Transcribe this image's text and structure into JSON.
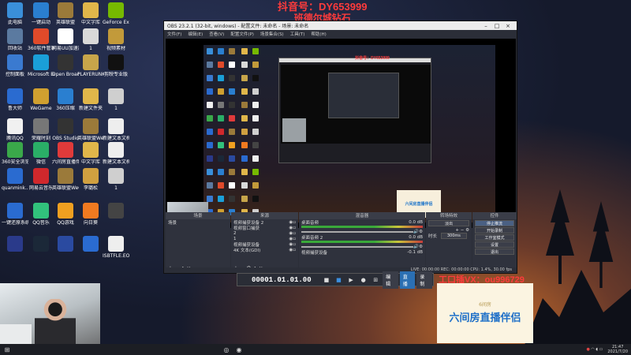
{
  "overlay": {
    "line1": "抖音号：DY653999",
    "line2": "班德尔城钻石"
  },
  "desktop_icons": [
    {
      "label": "此电脑",
      "icon": "computer-icon",
      "color": "#3a8fd9"
    },
    {
      "label": "一键启动",
      "icon": "gear-icon",
      "color": "#2a7fd0"
    },
    {
      "label": "英雄联盟",
      "icon": "lol-icon",
      "color": "#9b7a3a"
    },
    {
      "label": "中文字库",
      "icon": "folder-icon",
      "color": "#e0b64a"
    },
    {
      "label": "GeForce Experience",
      "icon": "nvidia-icon",
      "color": "#76b900"
    },
    {
      "label": "回收站",
      "icon": "recycle-bin-icon",
      "color": "#5b7aa0"
    },
    {
      "label": "360软件管家",
      "icon": "360-icon",
      "color": "#e04a2a"
    },
    {
      "label": "网易UU加速器",
      "icon": "uu-icon",
      "color": "#ffffff"
    },
    {
      "label": "1",
      "icon": "file-icon",
      "color": "#d9d9d9"
    },
    {
      "label": "视频素材",
      "icon": "folder-icon",
      "color": "#c29a3a"
    },
    {
      "label": "控制面板",
      "icon": "control-panel-icon",
      "color": "#3a7ad0"
    },
    {
      "label": "Microsoft Edge",
      "icon": "edge-icon",
      "color": "#1a9fd8"
    },
    {
      "label": "Open Broadcaster",
      "icon": "obs-icon",
      "color": "#333333"
    },
    {
      "label": "PLAYERUNKNOWN'S BATTLEGR...",
      "icon": "pubg-icon",
      "color": "#c7a54a"
    },
    {
      "label": "剪映专业版",
      "icon": "capcut-icon",
      "color": "#111111"
    },
    {
      "label": "鲁大师",
      "icon": "ludashi-icon",
      "color": "#2a6bd0"
    },
    {
      "label": "WeGame",
      "icon": "wegame-icon",
      "color": "#d0a030"
    },
    {
      "label": "360压缩",
      "icon": "zip-icon",
      "color": "#2a7fd0"
    },
    {
      "label": "新建文件夹",
      "icon": "folder-icon",
      "color": "#e0b64a"
    },
    {
      "label": "1",
      "icon": "file-icon",
      "color": "#cfcfcf"
    },
    {
      "label": "腾讯QQ",
      "icon": "qq-icon",
      "color": "#f0f0f0"
    },
    {
      "label": "荣耀时刻",
      "icon": "game-icon",
      "color": "#777777"
    },
    {
      "label": "OBS Studio",
      "icon": "obs-icon",
      "color": "#333333"
    },
    {
      "label": "英雄联盟WeGame版",
      "icon": "lol-icon",
      "color": "#9b7a3a"
    },
    {
      "label": "新建文本文档",
      "icon": "text-file-icon",
      "color": "#eeeeee"
    },
    {
      "label": "360安全浏览器",
      "icon": "browser-icon",
      "color": "#3aa84a"
    },
    {
      "label": "微信",
      "icon": "wechat-icon",
      "color": "#2aae67"
    },
    {
      "label": "六间房直播伴侣",
      "icon": "live-icon",
      "color": "#e03a3a"
    },
    {
      "label": "中文字库",
      "icon": "folder-icon",
      "color": "#e0b64a"
    },
    {
      "label": "新建文本文档 (2)",
      "icon": "text-file-icon",
      "color": "#eeeeee"
    },
    {
      "label": "quanmink...",
      "icon": "app-icon",
      "color": "#2a6bd0"
    },
    {
      "label": "网易云音乐",
      "icon": "music-icon",
      "color": "#d0282c"
    },
    {
      "label": "英雄联盟WeGame版",
      "icon": "lol-icon",
      "color": "#9b7a3a"
    },
    {
      "label": "李璐松",
      "icon": "folder-icon",
      "color": "#d0a040"
    },
    {
      "label": "1",
      "icon": "file-icon",
      "color": "#cfcfcf"
    },
    {
      "label": "一键还原系统",
      "icon": "restore-icon",
      "color": "#2a6bd0"
    },
    {
      "label": "QQ音乐",
      "icon": "qqmusic-icon",
      "color": "#31c27c"
    },
    {
      "label": "QQ游戏",
      "icon": "qqgame-icon",
      "color": "#f0a020"
    },
    {
      "label": "向日葵",
      "icon": "sunflower-icon",
      "color": "#f07a20"
    },
    {
      "label": "",
      "icon": "blank-icon",
      "color": "#444444"
    },
    {
      "label": "",
      "icon": "app-icon",
      "color": "#2a3a8a"
    },
    {
      "label": "",
      "icon": "steam-icon",
      "color": "#1b2838"
    },
    {
      "label": "",
      "icon": "app-icon",
      "color": "#2a4aa0"
    },
    {
      "label": "",
      "icon": "app-icon",
      "color": "#2a6bd0"
    },
    {
      "label": "ISBTFLE.EO...",
      "icon": "file-icon",
      "color": "#eeeeee"
    }
  ],
  "obs": {
    "title": "OBS 23.2.1 (32-bit, windows) - 配置文件: 未命名 - 场景: 未命名",
    "menu": [
      "文件(F)",
      "编辑(E)",
      "查看(V)",
      "配置文件(P)",
      "场景集合(S)",
      "工具(T)",
      "帮助(H)"
    ],
    "nested_overlay": "抖音号：DY653999",
    "promo_inner": "六间房直播伴侣",
    "scenes": {
      "header": "场景",
      "items": [
        "场景"
      ]
    },
    "sources": {
      "header": "来源",
      "items": [
        "视频捕获设备 2",
        "视频窗口捕获",
        "2",
        "1",
        "视频捕获设备",
        "4K 文本(GDI)"
      ]
    },
    "mixer": {
      "header": "混音器",
      "channels": [
        {
          "name": "桌面音频",
          "db": "0.0 dB"
        },
        {
          "name": "桌面音频 2",
          "db": "0.0 dB"
        },
        {
          "name": "视频捕获设备",
          "db": "-0.1 dB"
        }
      ]
    },
    "transitions": {
      "header": "转场特效",
      "type": "淡出",
      "duration_label": "时长",
      "duration": "300ms"
    },
    "controls": {
      "header": "控件",
      "buttons": [
        "停止推流",
        "开始录制",
        "工作室模式",
        "设置",
        "退出"
      ]
    },
    "status": "LIVE: 00:00:00   REC: 00:00:00   CPU: 1.4%, 30.00 fps"
  },
  "timebar": {
    "timecode": "00001.01.01.00",
    "buttons": [
      "编辑",
      "直播",
      "录制"
    ]
  },
  "vx": "工口插VX：ou996729",
  "promo": {
    "small": "6间房",
    "main": "六间房直播伴侣"
  },
  "taskbar": {
    "time": "21:47",
    "date": "2021/7/20"
  }
}
